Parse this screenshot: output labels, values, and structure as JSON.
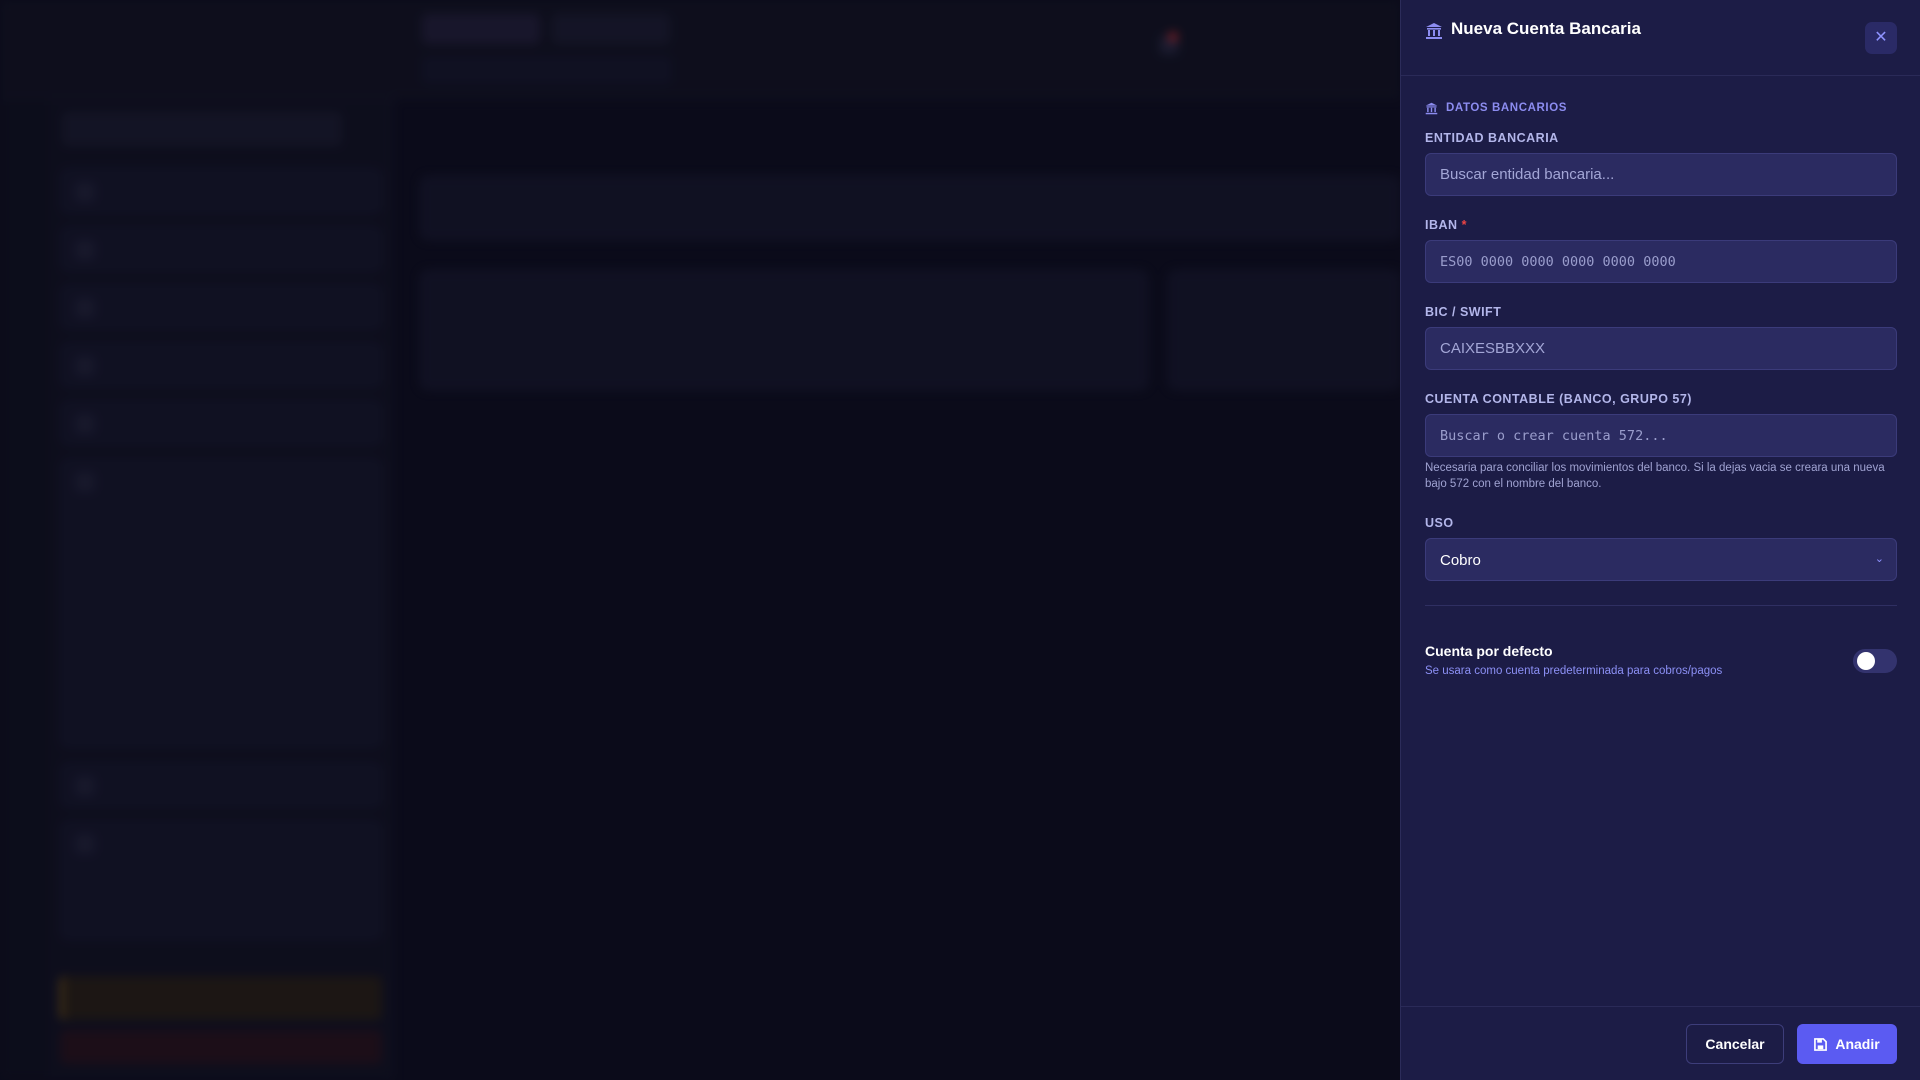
{
  "drawer": {
    "title": "Nueva Cuenta Bancaria",
    "close_icon": "close-icon",
    "section_title": "DATOS BANCARIOS",
    "fields": {
      "entity": {
        "label": "ENTIDAD BANCARIA",
        "placeholder": "Buscar entidad bancaria...",
        "value": ""
      },
      "iban": {
        "label": "IBAN",
        "required_mark": "*",
        "placeholder": "ES00 0000 0000 0000 0000 0000",
        "value": ""
      },
      "bic": {
        "label": "BIC / SWIFT",
        "placeholder": "CAIXESBBXXX",
        "value": ""
      },
      "account": {
        "label": "CUENTA CONTABLE (BANCO, GRUPO 57)",
        "placeholder": "Buscar o crear cuenta 572...",
        "value": "",
        "help": "Necesaria para conciliar los movimientos del banco. Si la dejas vacia se creara una nueva bajo 572 con el nombre del banco."
      },
      "usage": {
        "label": "USO",
        "selected": "Cobro"
      }
    },
    "default_toggle": {
      "title": "Cuenta por defecto",
      "description": "Se usara como cuenta predeterminada para cobros/pagos",
      "checked": false
    },
    "footer": {
      "cancel_label": "Cancelar",
      "add_label": "Anadir"
    }
  },
  "colors": {
    "accent": "#5b5bf2",
    "drawer_bg": "#1c1c46",
    "field_bg": "#2b2b61",
    "required": "#ef4444"
  }
}
